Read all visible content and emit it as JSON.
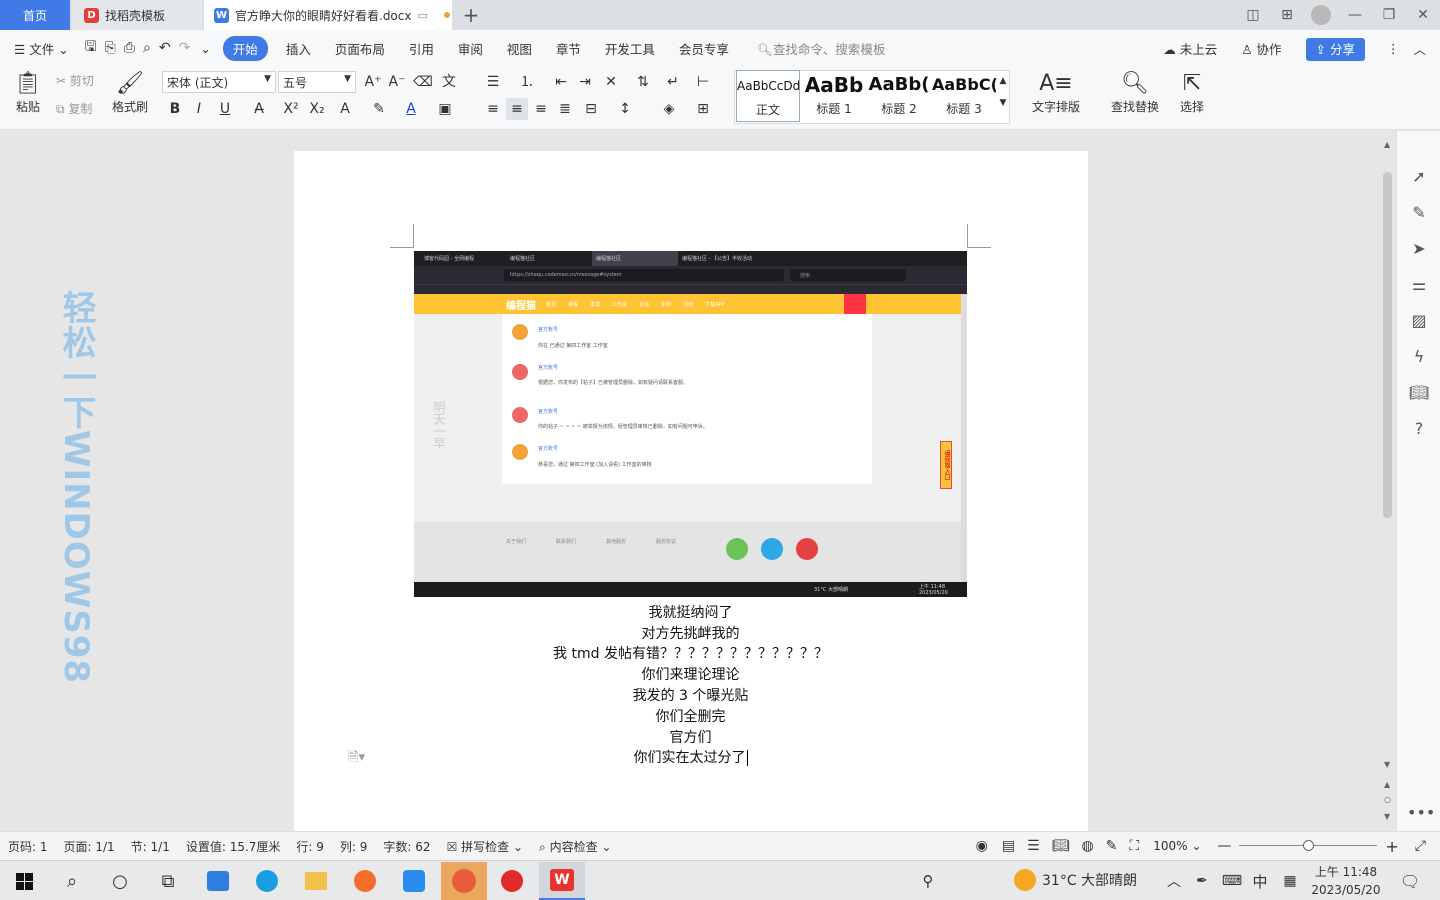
{
  "tabs": {
    "home": "首页",
    "templates": "找稻壳模板",
    "document": "官方睁大你的眼睛好好看看.docx",
    "add": "+"
  },
  "menu": {
    "file": "文件",
    "items": [
      "开始",
      "插入",
      "页面布局",
      "引用",
      "审阅",
      "视图",
      "章节",
      "开发工具",
      "会员专享"
    ],
    "search": "查找命令、搜索模板",
    "cloud": "未上云",
    "collab": "协作",
    "share": "分享"
  },
  "ribbon": {
    "paste": "粘贴",
    "cut": "剪切",
    "copy": "复制",
    "format_painter": "格式刷",
    "font_name": "宋体 (正文)",
    "font_size": "五号",
    "styles": [
      {
        "preview": "AaBbCcDd",
        "label": "正文"
      },
      {
        "preview": "AaBb",
        "label": "标题 1"
      },
      {
        "preview": "AaBb(",
        "label": "标题 2"
      },
      {
        "preview": "AaBbC(",
        "label": "标题 3"
      }
    ],
    "text_layout": "文字排版",
    "find_replace": "查找替换",
    "select": "选择"
  },
  "sidebar_text": "轻松一下WINDOWS98",
  "embedded": {
    "tabs": [
      "博客代码园 - 全网编程",
      "编程猫社区",
      "编程猫社区",
      "编程猫社区 - 【公告】丰收活动"
    ],
    "url": "https://shequ.codemao.cn/message#system",
    "search": "搜索",
    "logo": "编程猫",
    "nav": [
      "首页",
      "课程",
      "发现",
      "工作室",
      "论坛",
      "素材",
      "活动",
      "下载APP"
    ],
    "messages": [
      {
        "user": "官方账号",
        "text": "你在 已通过 第四工作室 工作室"
      },
      {
        "user": "官方账号",
        "text": "根据您，你发布的【帖子】已被管理员删除，如有疑问请联系客服。"
      },
      {
        "user": "官方账号",
        "text": "你的帖子 ~ ~ ~ ~ 被举报为违规，经管理员审核已删除，如有问题可申诉。"
      },
      {
        "user": "官方账号",
        "text": "恭喜您，通过 第四工作室 (加入请看) 工作室的审核"
      }
    ],
    "footer_cols": [
      "关于我们",
      "联系我们",
      "其他服务",
      "服务协议"
    ],
    "taskbar_weather": "31°C 大部晴朗",
    "time": "上午 11:48",
    "date": "2023/05/20",
    "side_banner": "编程猫入口"
  },
  "doc_lines": [
    "我就挺纳闷了",
    "对方先挑衅我的",
    "我 tmd 发帖有错？？？？？？？？？？？？",
    "你们来理论理论",
    "我发的 3 个曝光贴",
    "你们全删完",
    "官方们",
    "你们实在太过分了"
  ],
  "status": {
    "page": "页码: 1",
    "pages": "页面: 1/1",
    "section": "节: 1/1",
    "setting": "设置值: 15.7厘米",
    "row": "行: 9",
    "col": "列: 9",
    "words": "字数: 62",
    "spell": "拼写检查",
    "content_check": "内容检查",
    "zoom": "100%"
  },
  "taskbar": {
    "weather": "31°C  大部晴朗",
    "ime": "中",
    "time": "上午 11:48",
    "date": "2023/05/20"
  }
}
